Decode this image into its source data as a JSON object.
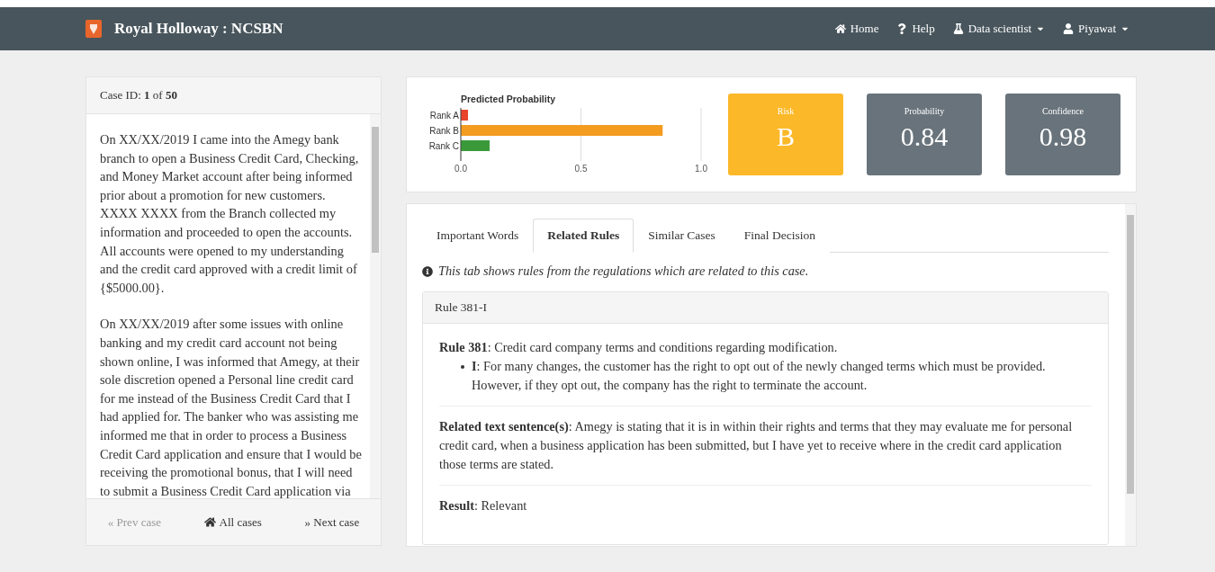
{
  "navbar": {
    "brand": "Royal Holloway : NCSBN",
    "links": [
      {
        "label": "Home",
        "kind": "home",
        "dropdown": false
      },
      {
        "label": "Help",
        "kind": "help",
        "dropdown": false
      },
      {
        "label": "Data scientist",
        "kind": "flask",
        "dropdown": true
      },
      {
        "label": "Piyawat",
        "kind": "user",
        "dropdown": true
      }
    ]
  },
  "case_panel": {
    "header": "Case ID: **1** of **50**",
    "paragraphs": [
      "On XX/XX/2019 I came into the Amegy bank branch to open a Business Credit Card, Checking, and Money Market account after being informed prior about a promotion for new customers. XXXX XXXX from the Branch collected my information and proceeded to open the accounts. All accounts were opened to my understanding and the credit card approved with a credit limit of {$5000.00}.",
      "On XX/XX/2019 after some issues with online banking and my credit card account not being shown online, I was informed that Amegy, at their sole discretion opened a Personal line credit card for me instead of the Business Credit Card that I had applied for. The banker who was assisting me informed me that in order to process a Business Credit Card application and ensure that I would be receiving the promotional bonus, that I will need to submit a Business Credit Card application via"
    ],
    "footer": [
      {
        "label": "« Prev case",
        "kind": "prev"
      },
      {
        "label": "All cases",
        "kind": "all"
      },
      {
        "label": "» Next case",
        "kind": "next"
      }
    ]
  },
  "prediction": {
    "chart_data": {
      "type": "bar",
      "orientation": "horizontal",
      "title": "Predicted Probability",
      "categories": [
        "Rank A",
        "Rank B",
        "Rank C"
      ],
      "series": [
        {
          "color": "#e8452c",
          "values": [
            0.03,
            null,
            null
          ]
        },
        {
          "color": "#f39c1f",
          "values": [
            null,
            0.84,
            null
          ]
        },
        {
          "color": "#3a9a3a",
          "values": [
            null,
            null,
            0.12
          ]
        }
      ],
      "xlim": [
        0,
        1
      ],
      "xticks": [
        {
          "value": 0,
          "label": "0.0"
        },
        {
          "value": 0.5,
          "label": "0.5"
        },
        {
          "value": 1,
          "label": "1.0"
        }
      ]
    },
    "stats": [
      {
        "label": "Risk",
        "value": "B",
        "kind": "risk"
      },
      {
        "label": "Probability",
        "value": "0.84",
        "kind": "metric"
      },
      {
        "label": "Confidence",
        "value": "0.98",
        "kind": "metric"
      }
    ]
  },
  "detail_panel": {
    "tabs": [
      {
        "label": "Important Words",
        "selected": false
      },
      {
        "label": "Related Rules",
        "selected": true
      },
      {
        "label": "Similar Cases",
        "selected": false
      },
      {
        "label": "Final Decision",
        "selected": false
      }
    ],
    "info": "This tab shows rules from the regulations which are related to this case.",
    "rule_card": {
      "header": "Rule 381-I",
      "rule": "**Rule 381**: Credit card company terms and conditions regarding modification.",
      "bullets": [
        "**I**: For many changes, the customer has the right to opt out of the newly changed terms which must be provided. However, if they opt out, the company has the right to terminate the account."
      ],
      "related": "**Related text sentence(s)**: Amegy is stating that it is in within their rights and terms that they may evaluate me for personal credit card, when a business application has been submitted, but I have yet to receive where in the credit card application those terms are stated.",
      "result": "**Result**: Relevant"
    }
  }
}
